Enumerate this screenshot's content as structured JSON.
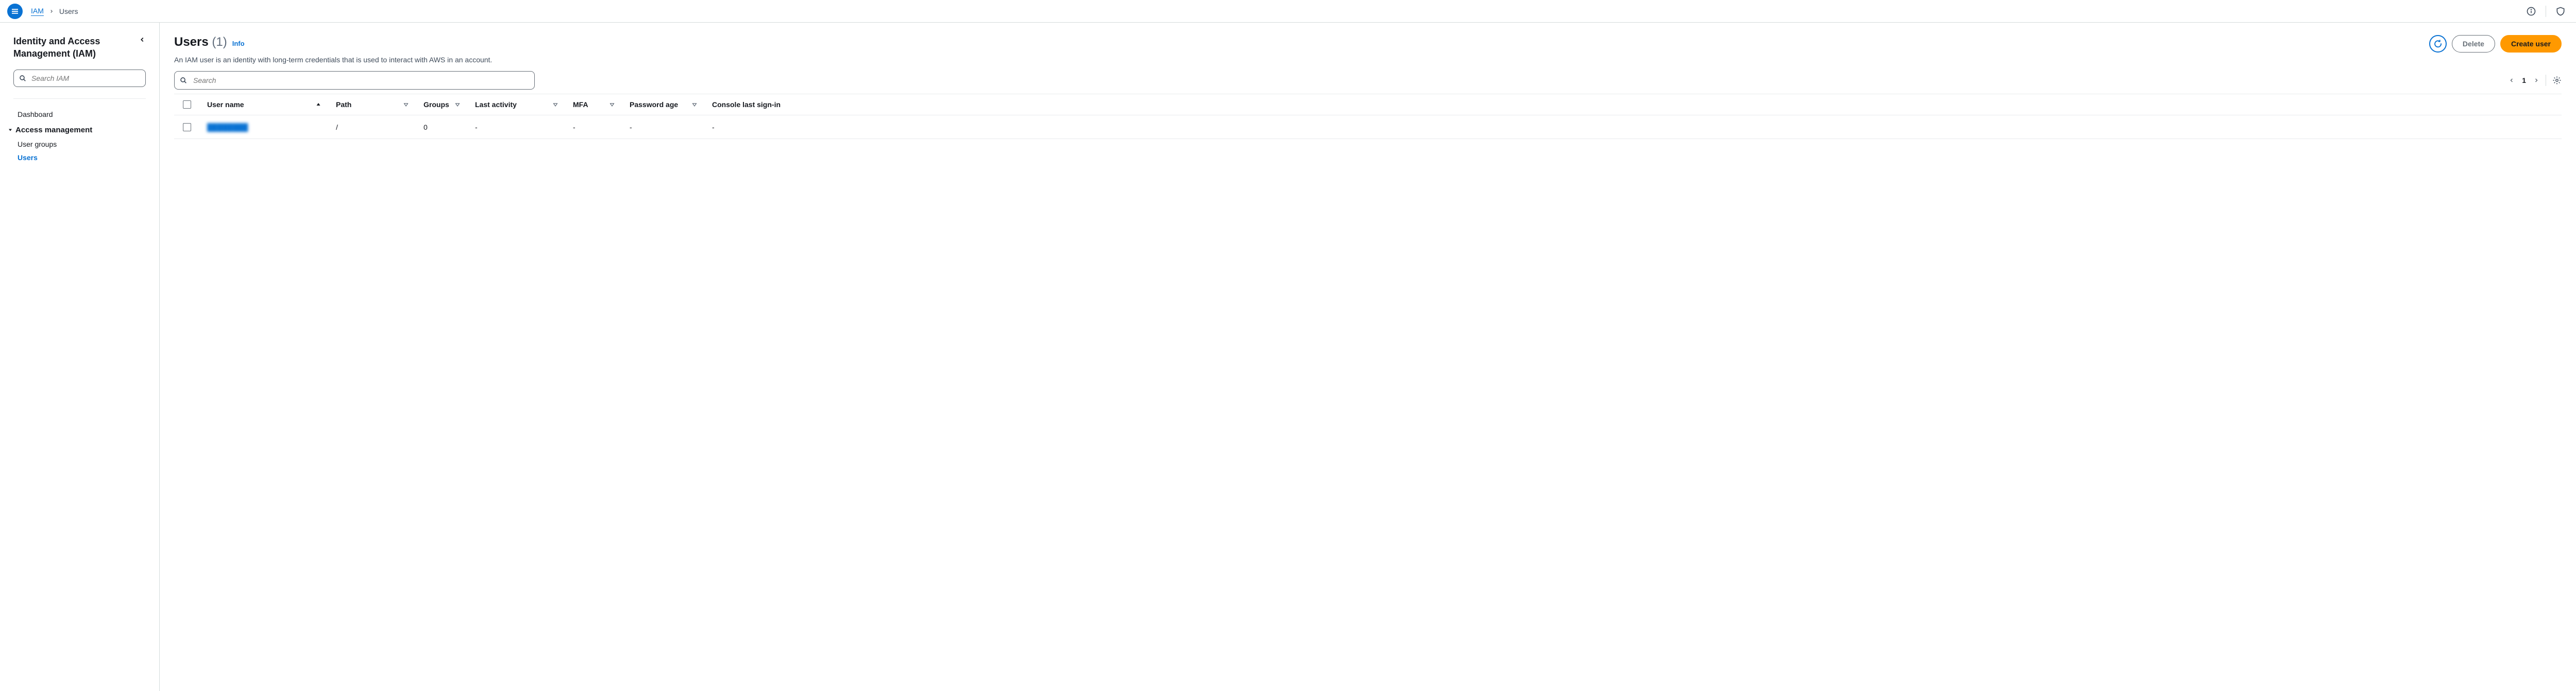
{
  "header": {
    "breadcrumb_root": "IAM",
    "breadcrumb_current": "Users"
  },
  "sidebar": {
    "title": "Identity and Access Management (IAM)",
    "search_placeholder": "Search IAM",
    "nav_dashboard": "Dashboard",
    "section_access": "Access management",
    "item_user_groups": "User groups",
    "item_users": "Users"
  },
  "content": {
    "title": "Users",
    "count_display": "(1)",
    "info_label": "Info",
    "subtitle": "An IAM user is an identity with long-term credentials that is used to interact with AWS in an account.",
    "delete_label": "Delete",
    "create_label": "Create user",
    "table_search_placeholder": "Search",
    "page_number": "1"
  },
  "table": {
    "columns": {
      "user": "User name",
      "path": "Path",
      "groups": "Groups",
      "last": "Last activity",
      "mfa": "MFA",
      "pwd": "Password age",
      "signin": "Console last sign-in"
    },
    "rows": [
      {
        "user": "████████",
        "path": "/",
        "groups": "0",
        "last": "-",
        "mfa": "-",
        "pwd": "-",
        "signin": "-"
      }
    ]
  }
}
